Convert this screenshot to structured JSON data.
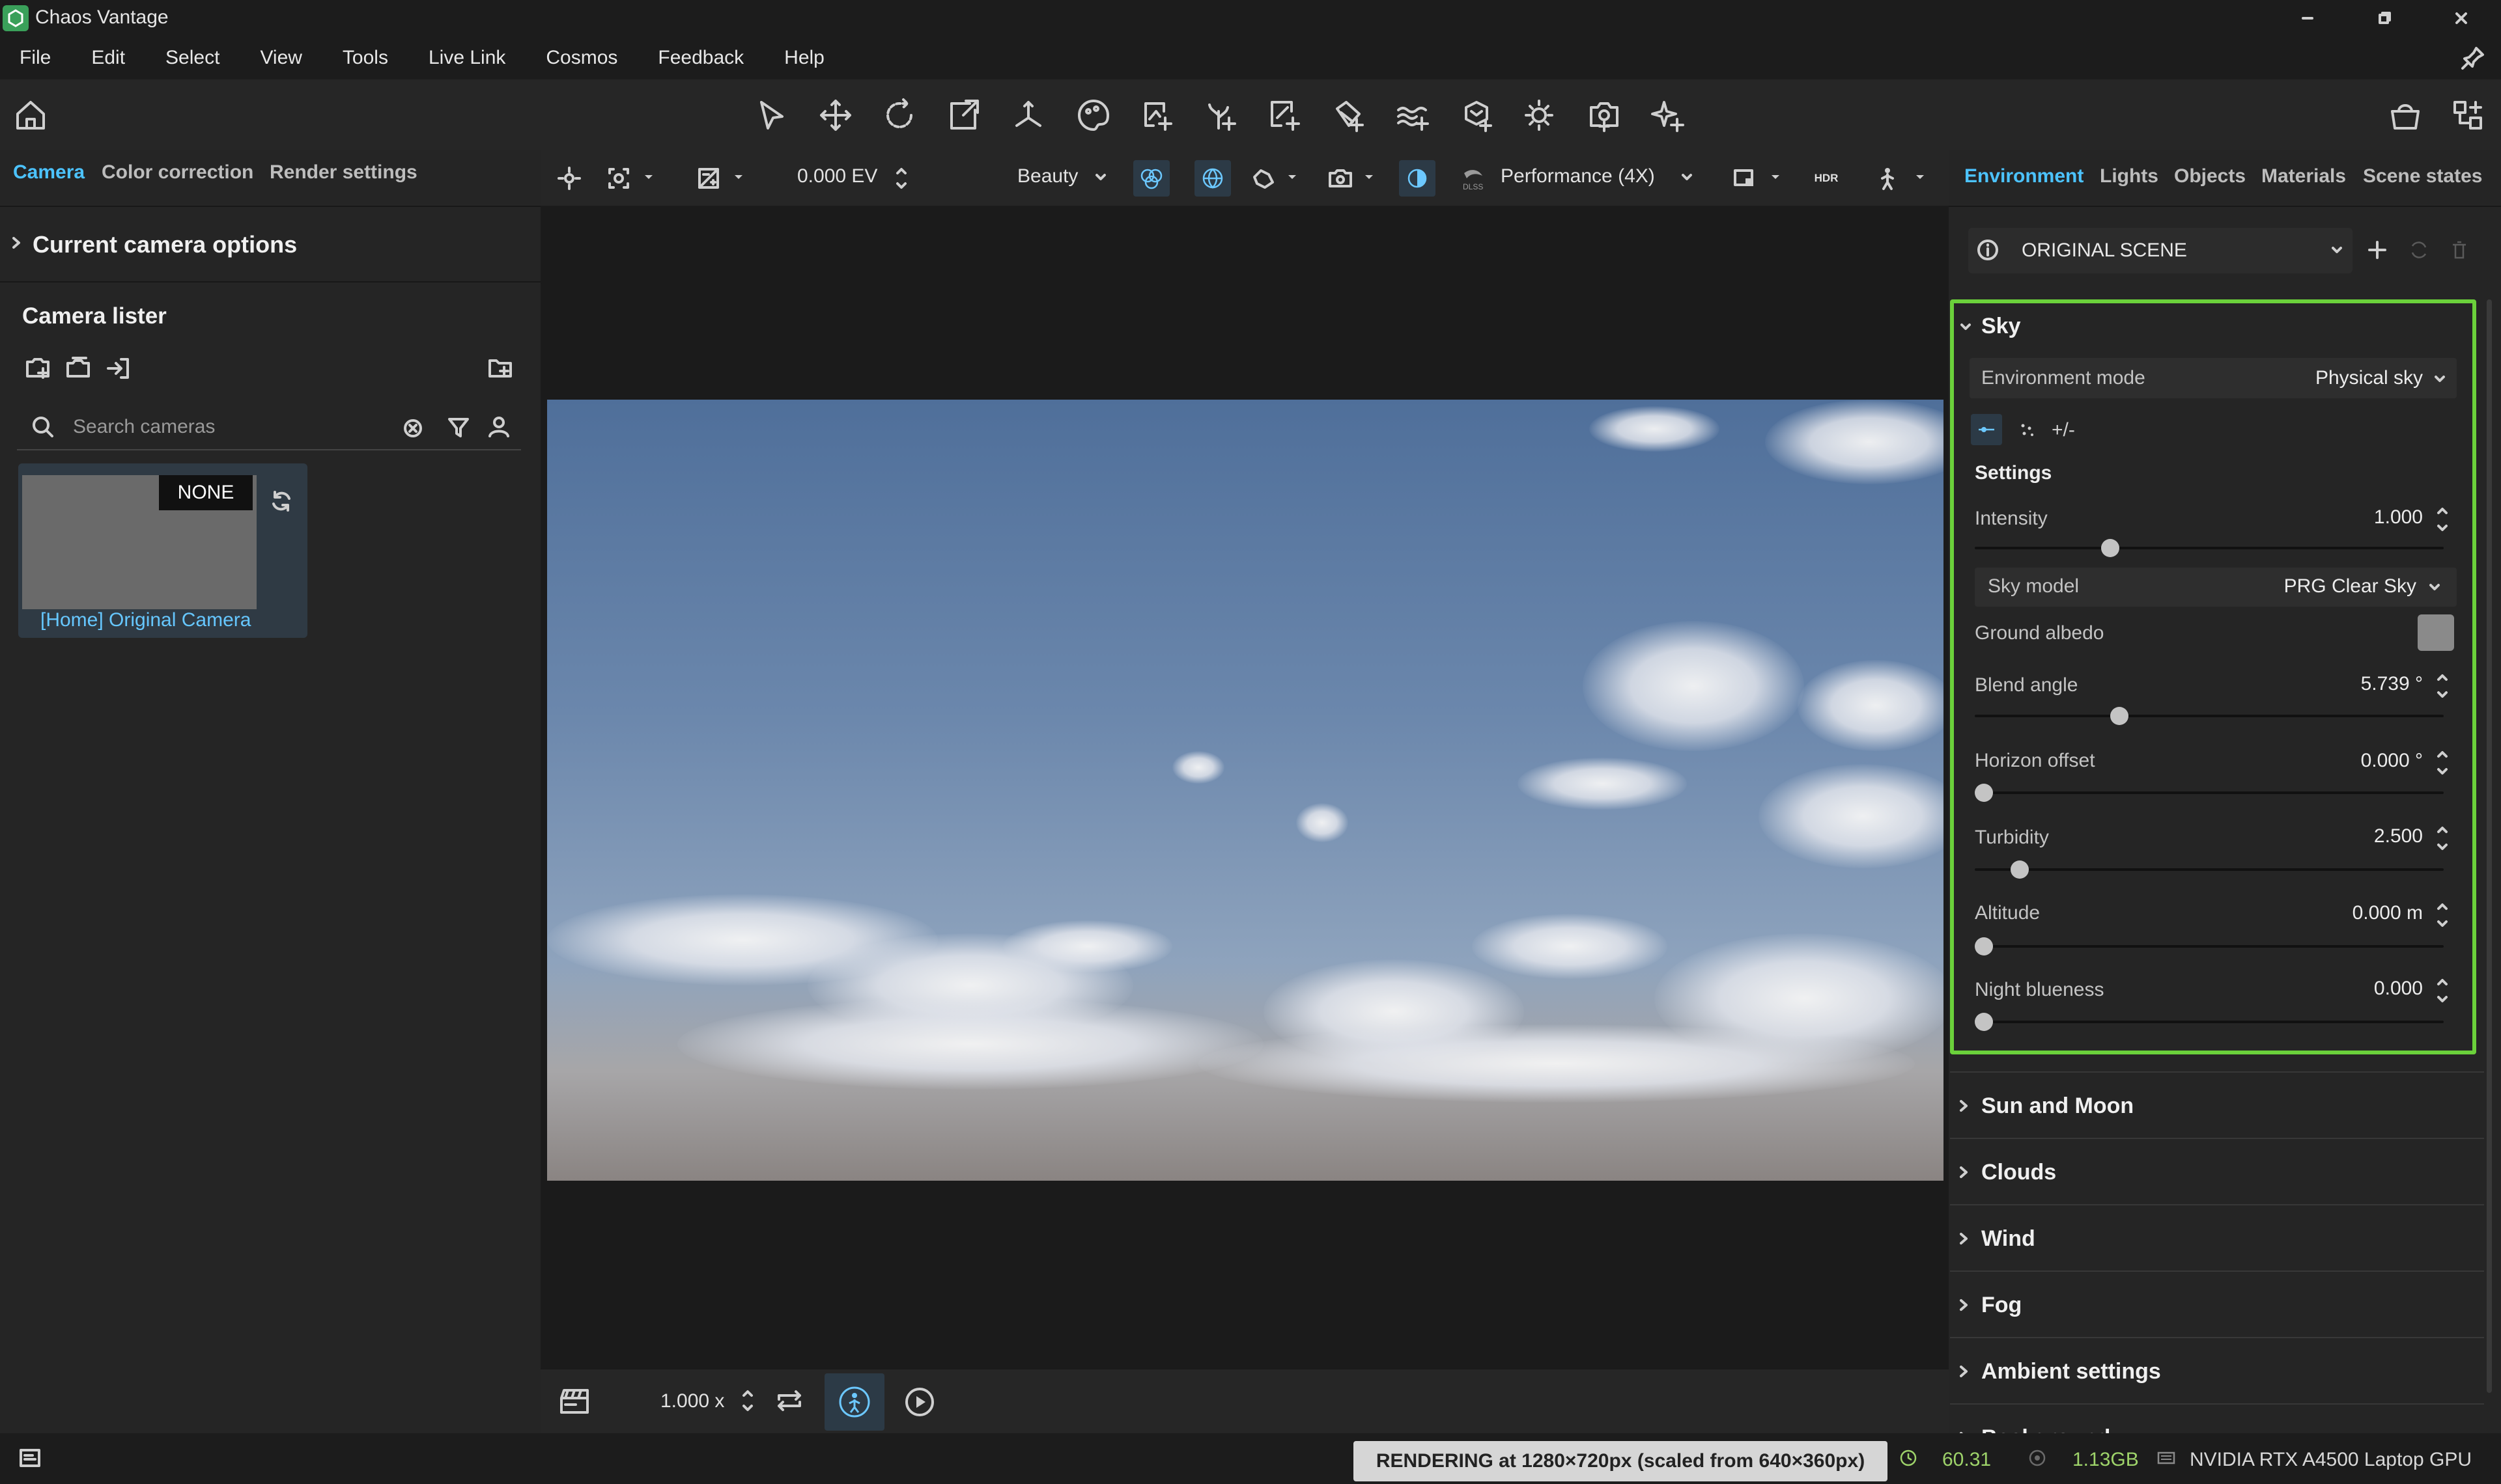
{
  "window": {
    "title": "Chaos Vantage"
  },
  "menu": [
    "File",
    "Edit",
    "Select",
    "View",
    "Tools",
    "Live Link",
    "Cosmos",
    "Feedback",
    "Help"
  ],
  "left_panel": {
    "tabs": [
      "Camera",
      "Color correction",
      "Render settings"
    ],
    "current_camera_options": "Current camera options",
    "lister_title": "Camera lister",
    "search_placeholder": "Search cameras",
    "camera": {
      "badge": "NONE",
      "name": "[Home] Original Camera"
    }
  },
  "viewport": {
    "exposure": "0.000 EV",
    "render_element": "Beauty",
    "dlss_label": "DLSS",
    "quality": "Performance (4X)",
    "hdr_label": "HDR",
    "speed": "1.000 x"
  },
  "right_panel": {
    "tabs": [
      "Environment",
      "Lights",
      "Objects",
      "Materials",
      "Scene states"
    ],
    "scene_state": "ORIGINAL SCENE",
    "sky": {
      "title": "Sky",
      "environment_mode_label": "Environment mode",
      "environment_mode_value": "Physical sky",
      "plus_minus": "+/-",
      "settings_title": "Settings",
      "intensity": {
        "label": "Intensity",
        "value": "1.000",
        "level": 0.28
      },
      "sky_model_label": "Sky model",
      "sky_model_value": "PRG Clear Sky",
      "ground_albedo_label": "Ground albedo",
      "ground_albedo_color": "#8a8a8a",
      "blend_angle": {
        "label": "Blend angle",
        "value": "5.739 °",
        "level": 0.3
      },
      "horizon_offset": {
        "label": "Horizon offset",
        "value": "0.000 °",
        "level": 0.0
      },
      "turbidity": {
        "label": "Turbidity",
        "value": "2.500",
        "level": 0.08
      },
      "altitude": {
        "label": "Altitude",
        "value": "0.000 m",
        "level": 0.0
      },
      "night_blueness": {
        "label": "Night blueness",
        "value": "0.000",
        "level": 0.0
      }
    },
    "sections": [
      "Sun and Moon",
      "Clouds",
      "Wind",
      "Fog",
      "Ambient settings",
      "Background"
    ]
  },
  "status": {
    "rendering": "RENDERING at 1280×720px (scaled from 640×360px)",
    "fps": "60.31",
    "memory": "1.13GB",
    "gpu": "NVIDIA RTX A4500 Laptop GPU"
  },
  "colors": {
    "accent": "#4cc3ff",
    "highlight_border": "#6bd13b",
    "fps": "#9ed36a"
  }
}
